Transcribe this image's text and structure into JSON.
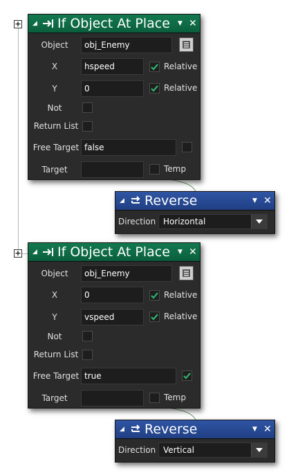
{
  "block1": {
    "title": "If Object At Place",
    "object_label": "Object",
    "object_value": "obj_Enemy",
    "x_label": "X",
    "x_value": "hspeed",
    "x_relative_label": "Relative",
    "x_relative": true,
    "y_label": "Y",
    "y_value": "0",
    "y_relative_label": "Relative",
    "y_relative": true,
    "not_label": "Not",
    "not_checked": false,
    "return_list_label": "Return List",
    "return_list_checked": false,
    "free_target_label": "Free Target",
    "free_target_value": "false",
    "free_target_checked": false,
    "target_label": "Target",
    "target_value": "",
    "temp_label": "Temp",
    "temp_checked": false
  },
  "reverse1": {
    "title": "Reverse",
    "direction_label": "Direction",
    "direction_value": "Horizontal"
  },
  "block2": {
    "title": "If Object At Place",
    "object_label": "Object",
    "object_value": "obj_Enemy",
    "x_label": "X",
    "x_value": "0",
    "x_relative_label": "Relative",
    "x_relative": true,
    "y_label": "Y",
    "y_value": "vspeed",
    "y_relative_label": "Relative",
    "y_relative": true,
    "not_label": "Not",
    "not_checked": false,
    "return_list_label": "Return List",
    "return_list_checked": false,
    "free_target_label": "Free Target",
    "free_target_value": "true",
    "free_target_checked": true,
    "target_label": "Target",
    "target_value": "",
    "temp_label": "Temp",
    "temp_checked": false
  },
  "reverse2": {
    "title": "Reverse",
    "direction_label": "Direction",
    "direction_value": "Vertical"
  },
  "expander_glyph": "+",
  "colors": {
    "condition_header": "#0f6b45",
    "action_header": "#2a4b98",
    "panel_bg": "#2b2b2b",
    "check": "#2fb36f"
  },
  "icons": [
    "if-object-arrow-icon",
    "reverse-arrow-icon",
    "object-picker-icon",
    "check-icon",
    "close-icon",
    "collapse-triangle-icon",
    "menu-triangle-icon",
    "dropdown-arrow-icon"
  ]
}
